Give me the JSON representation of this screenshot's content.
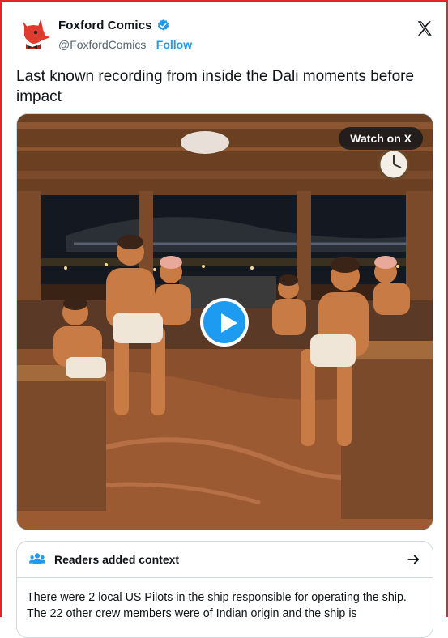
{
  "author": {
    "display_name": "Foxford Comics",
    "handle": "@FoxfordComics",
    "separator": "·",
    "follow_label": "Follow"
  },
  "tweet": {
    "text": "Last known recording from inside the Dali moments before impact"
  },
  "media": {
    "type": "video",
    "watch_label": "Watch on X"
  },
  "community_note": {
    "title": "Readers added context",
    "body": "There were 2 local US Pilots in the ship responsible for operating the ship. The 22 other crew members were of Indian origin and the ship is"
  },
  "colors": {
    "accent": "#1d9bf0",
    "frame_border": "#e0262b",
    "text": "#0f1419",
    "muted": "#536471"
  },
  "icons": {
    "verified": "verified-badge-icon",
    "platform": "x-logo-icon",
    "notes": "people-icon",
    "expand": "arrow-right-icon",
    "play": "play-icon"
  }
}
